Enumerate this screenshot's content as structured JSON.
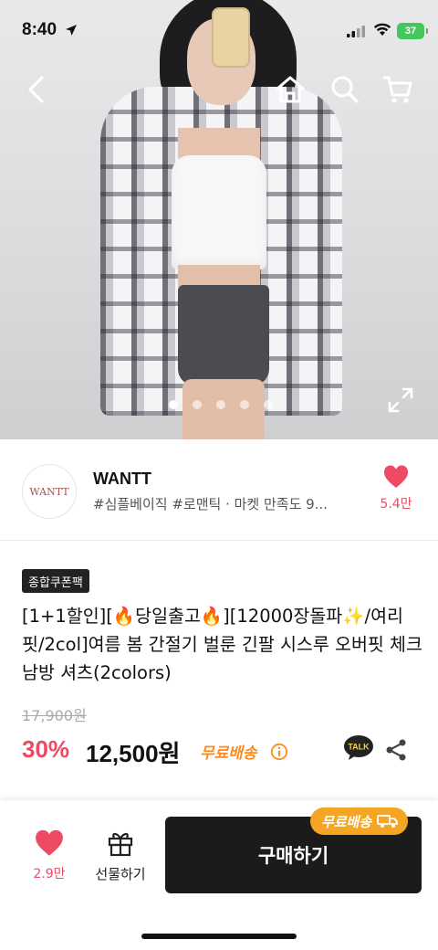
{
  "status_bar": {
    "time": "8:40",
    "battery": "37"
  },
  "header": {
    "back_icon": "chevron-left-icon",
    "home_icon": "home-icon",
    "search_icon": "search-icon",
    "cart_icon": "cart-icon"
  },
  "gallery": {
    "total_images": 5,
    "current_index": 0,
    "expand_icon": "expand-icon"
  },
  "store": {
    "logo_text": "WANTT",
    "name": "WANTT",
    "tags": "#심플베이직 #로맨틱 · 마켓 만족도 9...",
    "like_count": "5.4만"
  },
  "product": {
    "badge": "종합쿠폰팩",
    "title": "[1+1할인][🔥당일출고🔥][12000장돌파✨/여리핏/2col]여름 봄 간절기 벌룬 긴팔 시스루 오버핏 체크 남방 셔츠(2colors)",
    "original_price": "17,900원",
    "discount": "30%",
    "price": "12,500원",
    "shipping": "무료배송"
  },
  "bottom_bar": {
    "like_count": "2.9만",
    "gift_label": "선물하기",
    "buy_label": "구매하기",
    "shipping_pill": "무료배송"
  },
  "colors": {
    "accent_red": "#ef4a63",
    "shipping_orange": "#ff8a1f",
    "pill_orange": "#f5a524",
    "buy_button": "#1b1b1b",
    "battery_green": "#43c65a"
  }
}
